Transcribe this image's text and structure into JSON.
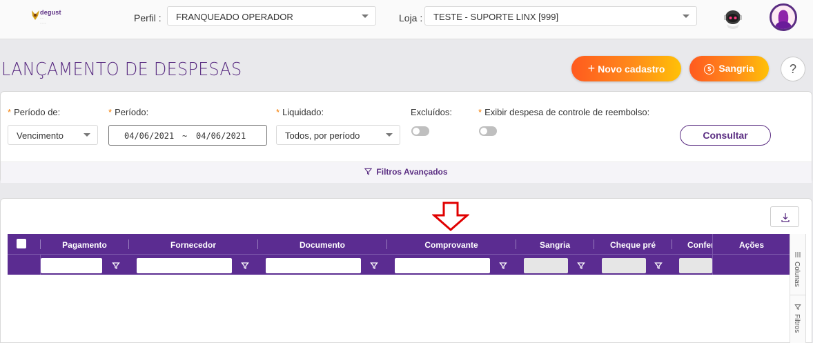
{
  "header": {
    "logo_brand": "degust",
    "profile_label": "Perfil :",
    "profile_value": "FRANQUEADO OPERADOR",
    "store_label": "Loja :",
    "store_value": "TESTE - SUPORTE LINX [999]"
  },
  "page": {
    "title": "LANÇAMENTO DE DESPESAS",
    "new_button": "Novo cadastro",
    "sangria_button": "Sangria",
    "help_label": "?"
  },
  "filters": {
    "periodo_de_label": "Período de:",
    "periodo_de_value": "Vencimento",
    "periodo_label": "Período:",
    "date_start": "04/06/2021",
    "date_sep": "~",
    "date_end": "04/06/2021",
    "liquidado_label": "Liquidado:",
    "liquidado_value": "Todos, por período",
    "excluidos_label": "Excluídos:",
    "excluidos_on": false,
    "reembolso_label": "Exibir despesa de controle de reembolso:",
    "reembolso_on": false,
    "consultar_button": "Consultar",
    "advanced_label": "Filtros Avançados"
  },
  "grid": {
    "columns": [
      "Pagamento",
      "Fornecedor",
      "Documento",
      "Comprovante",
      "Sangria",
      "Cheque pré",
      "Conferi",
      "Ações"
    ],
    "side_tabs": [
      "Colunas",
      "Filtros"
    ]
  },
  "colors": {
    "primary": "#5b2c91",
    "accent_orange": "#ff5a1f",
    "accent_yellow": "#ffc107",
    "required": "#f57c00",
    "arrow": "#e00000"
  }
}
